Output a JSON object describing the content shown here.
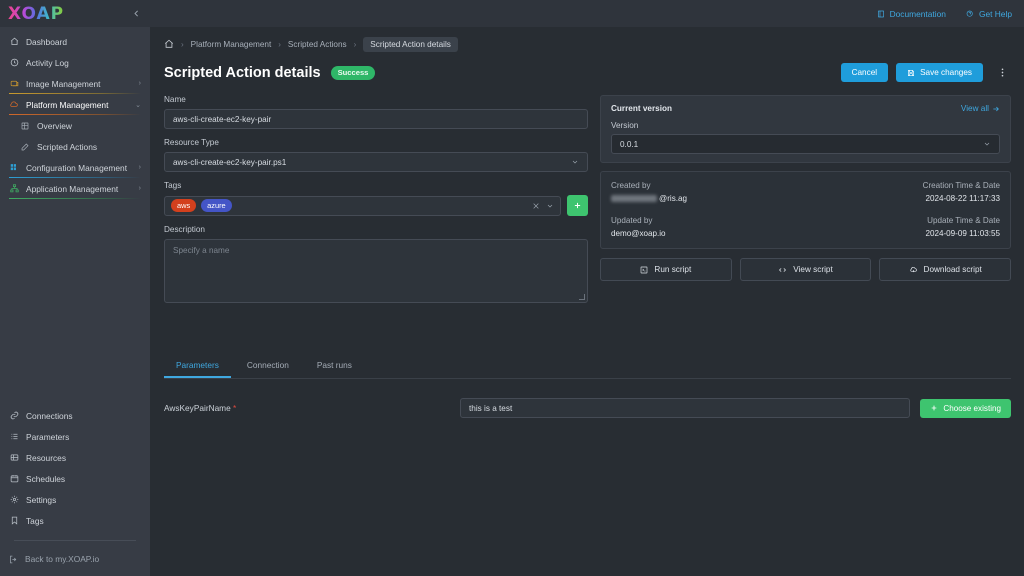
{
  "sidebar": {
    "logo": "XOAP",
    "collapse_icon": "chevron-left-icon",
    "items": [
      {
        "label": "Dashboard",
        "icon": "home-icon",
        "level": 0,
        "chevron": "",
        "underline": ""
      },
      {
        "label": "Activity Log",
        "icon": "clock-icon",
        "level": 0,
        "chevron": "",
        "underline": ""
      },
      {
        "label": "Image Management",
        "icon": "image-icon",
        "level": 0,
        "chevron": "›",
        "underline": "gold"
      },
      {
        "label": "Platform Management",
        "icon": "cloud-icon",
        "level": 0,
        "chevron": "⌄",
        "underline": "orange"
      },
      {
        "label": "Overview",
        "icon": "grid-icon",
        "level": 1,
        "chevron": "",
        "underline": ""
      },
      {
        "label": "Scripted Actions",
        "icon": "pencil-icon",
        "level": 1,
        "chevron": "",
        "underline": ""
      },
      {
        "label": "Configuration Management",
        "icon": "blocks-icon",
        "level": 0,
        "chevron": "›",
        "underline": "blue"
      },
      {
        "label": "Application Management",
        "icon": "sitemap-icon",
        "level": 0,
        "chevron": "›",
        "underline": "green"
      }
    ],
    "bottom_items": [
      {
        "label": "Connections",
        "icon": "link-icon"
      },
      {
        "label": "Parameters",
        "icon": "list-icon"
      },
      {
        "label": "Resources",
        "icon": "database-icon"
      },
      {
        "label": "Schedules",
        "icon": "calendar-icon"
      },
      {
        "label": "Settings",
        "icon": "gear-icon"
      },
      {
        "label": "Tags",
        "icon": "bookmark-icon"
      }
    ],
    "back_label": "Back to my.XOAP.io",
    "back_icon": "logout-icon"
  },
  "topbar": {
    "documentation": "Documentation",
    "documentation_icon": "book-icon",
    "get_help": "Get Help",
    "get_help_icon": "help-icon"
  },
  "breadcrumb": {
    "home_icon": "home-icon",
    "items": [
      "Platform Management",
      "Scripted Actions"
    ],
    "current": "Scripted Action details"
  },
  "page": {
    "title": "Scripted Action details",
    "status_badge": "Success",
    "cancel_label": "Cancel",
    "save_label": "Save changes",
    "save_icon": "save-icon",
    "kebab_icon": "more-vertical-icon"
  },
  "form": {
    "name_label": "Name",
    "name_value": "aws-cli-create-ec2-key-pair",
    "resource_type_label": "Resource Type",
    "resource_type_value": "aws-cli-create-ec2-key-pair.ps1",
    "tags_label": "Tags",
    "tags": [
      "aws",
      "azure"
    ],
    "tag_colors": {
      "aws": "#d3401d",
      "azure": "#4455c7"
    },
    "clear_icon": "close-icon",
    "dropdown_icon": "chevron-down-icon",
    "add_tag_icon": "plus-icon",
    "description_label": "Description",
    "description_placeholder": "Specify a name",
    "description_value": ""
  },
  "version_panel": {
    "title": "Current version",
    "view_all": "View all",
    "view_all_icon": "arrow-right-icon",
    "version_label": "Version",
    "version_value": "0.0.1"
  },
  "meta_panel": {
    "created_by_label": "Created by",
    "created_by_value": "@ris.ag",
    "created_by_redacted": true,
    "creation_time_label": "Creation Time & Date",
    "creation_time_value": "2024-08-22 11:17:33",
    "updated_by_label": "Updated by",
    "updated_by_value": "demo@xoap.io",
    "update_time_label": "Update Time & Date",
    "update_time_value": "2024-09-09 11:03:55"
  },
  "script_actions": [
    {
      "label": "Run script",
      "icon": "terminal-icon"
    },
    {
      "label": "View script",
      "icon": "code-icon"
    },
    {
      "label": "Download script",
      "icon": "download-cloud-icon"
    }
  ],
  "tabs": [
    {
      "label": "Parameters",
      "active": true
    },
    {
      "label": "Connection",
      "active": false
    },
    {
      "label": "Past runs",
      "active": false
    }
  ],
  "parameters": [
    {
      "name": "AwsKeyPairName",
      "required": "*",
      "value": "this is a test",
      "choose_label": "Choose existing",
      "choose_icon": "plus-icon"
    }
  ],
  "colors": {
    "accent_blue": "#3fa8e0",
    "primary_button": "#1f9ddb",
    "success_green": "#2fb768",
    "add_green": "#3ec46f",
    "bg_main": "#282d33",
    "bg_sidebar": "#373c45",
    "bg_panel": "#31373f",
    "required_red": "#e04a3f"
  }
}
